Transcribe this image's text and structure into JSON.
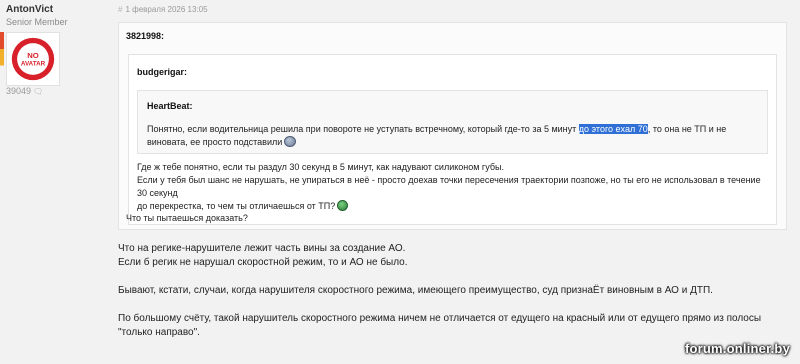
{
  "author": {
    "username": "AntonVict",
    "rank": "Senior Member",
    "avatar_text": [
      "NO",
      "AVATAR"
    ],
    "post_count": "39049"
  },
  "post": {
    "hash": "#",
    "timestamp": "1 февраля 2026 13:05",
    "quote_outer": {
      "author": "3821998:",
      "tail_text": "Что ты пытаешься доказать?"
    },
    "quote_mid": {
      "author": "budgerigar:",
      "lines": [
        "Где ж тебе понятно, если ты раздул 30 секунд в 5 минут, как надувают силиконом губы.",
        "Если у тебя был шанс не нарушать, не упираться в неё - просто доехав точки пересечения траектории позпоже, но ты его не использовал в течение 30 секунд",
        "до перекрестка, то чем ты отличаешься от ТП?"
      ]
    },
    "quote_inner": {
      "author": "HeartBeat:",
      "text_before": "Понятно, если водительница решила при повороте не уступать встречному, который где-то за 5 минут ",
      "highlight": "до этого exал 70",
      "text_after": ", то она не ТП и не виновата, ее просто подставили"
    },
    "body": [
      [
        "Что на регике-нарушителе лежит часть вины за создание АО.",
        "Если б регик не нарушал скоростной режим, то и АО не было."
      ],
      [
        "Бывают, кстати, случаи, когда нарушителя скоростного режима, имеющего преимущество, суд признаЁт виновным в АО и ДТП."
      ],
      [
        "По большому счёту, такой нарушитель скоростного режима ничем не отличается от едущего на красный или от едущего прямо из полосы",
        "\"только направо\"."
      ]
    ]
  },
  "watermark": "forum.onliner.by",
  "colors": {
    "highlight": "#2f6fd6",
    "avatar_red": "#d7202a",
    "background": "#f2f2f2"
  },
  "icons": {
    "avatar": "no-avatar-badge",
    "post_count": "speech-bubble-icon",
    "emoji_inner": "tp-smiley-icon",
    "emoji_mid": "grin-smiley-icon"
  }
}
